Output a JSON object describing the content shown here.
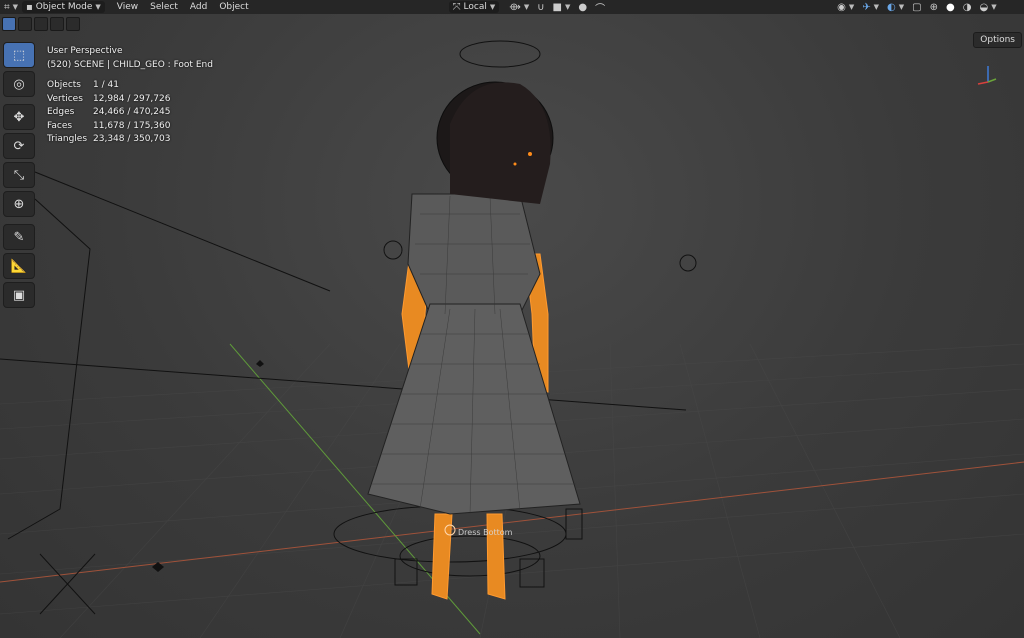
{
  "header": {
    "mode": "Object Mode",
    "menus": [
      "View",
      "Select",
      "Add",
      "Object"
    ],
    "transform_orientation": "Local",
    "options_label": "Options"
  },
  "viewport": {
    "view_name": "User Perspective",
    "collection_line": "(520) SCENE | CHILD_GEO : Foot End",
    "stats": [
      {
        "label": "Objects",
        "value": "1 / 41"
      },
      {
        "label": "Vertices",
        "value": "12,984 / 297,726"
      },
      {
        "label": "Edges",
        "value": "24,466 / 470,245"
      },
      {
        "label": "Faces",
        "value": "11,678 / 175,360"
      },
      {
        "label": "Triangles",
        "value": "23,348 / 350,703"
      }
    ],
    "object_label": "Dress Bottom",
    "gizmo_axes": [
      "X",
      "Z",
      "Y"
    ]
  },
  "toolbar": {
    "tools": [
      {
        "name": "select-box",
        "icon": "cursor-arrow-icon",
        "glyph": "⬚"
      },
      {
        "name": "cursor",
        "icon": "crosshair-cursor-icon",
        "glyph": "◎"
      },
      {
        "name": "move",
        "icon": "move-arrows-icon",
        "glyph": "✥"
      },
      {
        "name": "rotate",
        "icon": "rotate-icon",
        "glyph": "⟳"
      },
      {
        "name": "scale",
        "icon": "scale-icon",
        "glyph": "⤡"
      },
      {
        "name": "transform",
        "icon": "transform-icon",
        "glyph": "⊕"
      },
      {
        "name": "annotate",
        "icon": "pencil-icon",
        "glyph": "✎"
      },
      {
        "name": "measure",
        "icon": "ruler-icon",
        "glyph": "📐"
      },
      {
        "name": "add-cube",
        "icon": "add-cube-icon",
        "glyph": "▣"
      }
    ]
  },
  "colors": {
    "accent": "#4772b3",
    "selection": "#ff8c1a",
    "x_axis": "#a0523a",
    "y_axis": "#5f9a3a",
    "header_bg": "#262626"
  }
}
